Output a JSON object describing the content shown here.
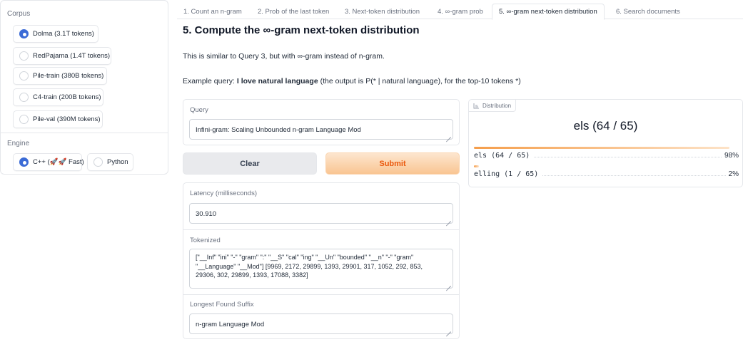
{
  "corpus": {
    "label": "Corpus",
    "options": [
      {
        "label": "Dolma (3.1T tokens)",
        "selected": true
      },
      {
        "label": "RedPajama (1.4T tokens)",
        "selected": false
      },
      {
        "label": "Pile-train (380B tokens)",
        "selected": false
      },
      {
        "label": "C4-train (200B tokens)",
        "selected": false
      },
      {
        "label": "Pile-val (390M tokens)",
        "selected": false
      }
    ]
  },
  "engine": {
    "label": "Engine",
    "options": [
      {
        "label": "C++ (🚀🚀 Fast)",
        "selected": true
      },
      {
        "label": "Python",
        "selected": false
      }
    ]
  },
  "tabs": [
    {
      "label": "1. Count an n-gram",
      "active": false
    },
    {
      "label": "2. Prob of the last token",
      "active": false
    },
    {
      "label": "3. Next-token distribution",
      "active": false
    },
    {
      "label": "4. ∞-gram prob",
      "active": false
    },
    {
      "label": "5. ∞-gram next-token distribution",
      "active": true
    },
    {
      "label": "6. Search documents",
      "active": false
    }
  ],
  "main": {
    "title": "5. Compute the ∞-gram next-token distribution",
    "description": "This is similar to Query 3, but with ∞-gram instead of n-gram.",
    "example_prefix": "Example query: ",
    "example_query": "I love natural language",
    "example_suffix": " (the output is P(* | natural language), for the top-10 tokens *)"
  },
  "query": {
    "label": "Query",
    "value": "Infini-gram: Scaling Unbounded n-gram Language Mod"
  },
  "buttons": {
    "clear": "Clear",
    "submit": "Submit"
  },
  "latency": {
    "label": "Latency (milliseconds)",
    "value": "30.910"
  },
  "tokenized": {
    "label": "Tokenized",
    "value": "[\"__Inf\" \"ini\" \"-\" \"gram\" \":\" \"__S\" \"cal\" \"ing\" \"__Un\" \"bounded\" \"__n\" \"-\" \"gram\" \"__Language\" \"__Mod\"] [9969, 2172, 29899, 1393, 29901, 317, 1052, 292, 853, 29306, 302, 29899, 1393, 17088, 3382]"
  },
  "suffix": {
    "label": "Longest Found Suffix",
    "value": "n-gram Language Mod"
  },
  "distribution": {
    "tag": "Distribution",
    "top_label": "els (64 / 65)",
    "bar_color": "#f59e4b",
    "items": [
      {
        "label": "els (64 / 65)",
        "percent": "98%",
        "fraction": 0.98
      },
      {
        "label": "elling (1 / 65)",
        "percent": "2%",
        "fraction": 0.02
      }
    ]
  }
}
